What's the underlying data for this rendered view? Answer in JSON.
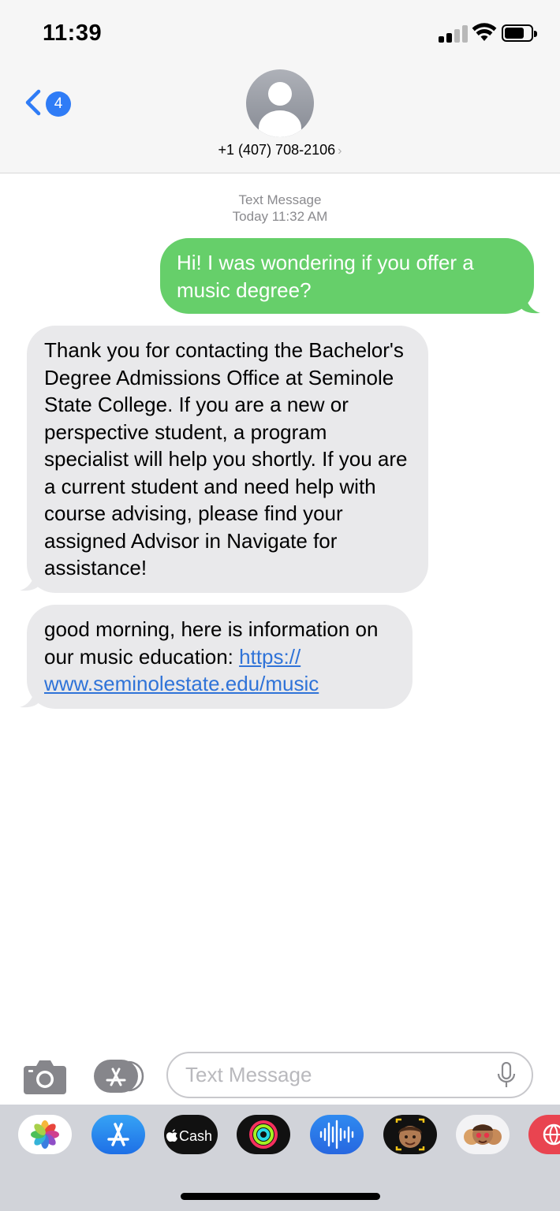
{
  "status_bar": {
    "time": "11:39",
    "signal_icon": "cellular-signal-icon",
    "wifi_icon": "wifi-icon",
    "battery_icon": "battery-icon",
    "battery_level": 0.75
  },
  "header": {
    "back_icon": "chevron-left-icon",
    "unread_count": "4",
    "avatar_icon": "person-silhouette-icon",
    "contact": "+1 (407) 708-2106",
    "contact_chevron": "›"
  },
  "conversation": {
    "service_label": "Text Message",
    "timestamp": "Today 11:32 AM",
    "messages": [
      {
        "direction": "outgoing",
        "text": "Hi! I was wondering if you offer a music degree?"
      },
      {
        "direction": "incoming",
        "text": "Thank you for contacting the Bachelor's Degree Admissions Office at Seminole State College.  If you are a new or perspective student, a program specialist will help you shortly. If you are a current student and need help with course advising, please find your assigned Advisor in Navigate for assistance!"
      },
      {
        "direction": "incoming",
        "text": "good morning, here is information on our music education: ",
        "link_part1": "https://",
        "link_part2": "www.seminolestate.edu/music"
      }
    ]
  },
  "input_bar": {
    "camera_icon": "camera-icon",
    "apps_icon": "app-store-icon",
    "placeholder": "Text Message",
    "mic_icon": "microphone-icon"
  },
  "app_drawer": {
    "apps": [
      {
        "name": "Photos",
        "icon": "photos-app-icon"
      },
      {
        "name": "App Store",
        "icon": "app-store-app-icon"
      },
      {
        "name": "Cash",
        "label": "Cash",
        "icon": "apple-cash-icon"
      },
      {
        "name": "Activity",
        "icon": "activity-rings-icon"
      },
      {
        "name": "Audio",
        "icon": "audio-waveform-icon"
      },
      {
        "name": "Memoji",
        "icon": "memoji-icon"
      },
      {
        "name": "Memoji Stickers",
        "icon": "memoji-stickers-icon"
      },
      {
        "name": "Web Images",
        "icon": "globe-search-icon"
      }
    ]
  },
  "colors": {
    "accent_blue": "#2f7cf6",
    "sms_green": "#66cf6a",
    "incoming_gray": "#e9e9eb",
    "link_blue": "#2f73d8"
  }
}
